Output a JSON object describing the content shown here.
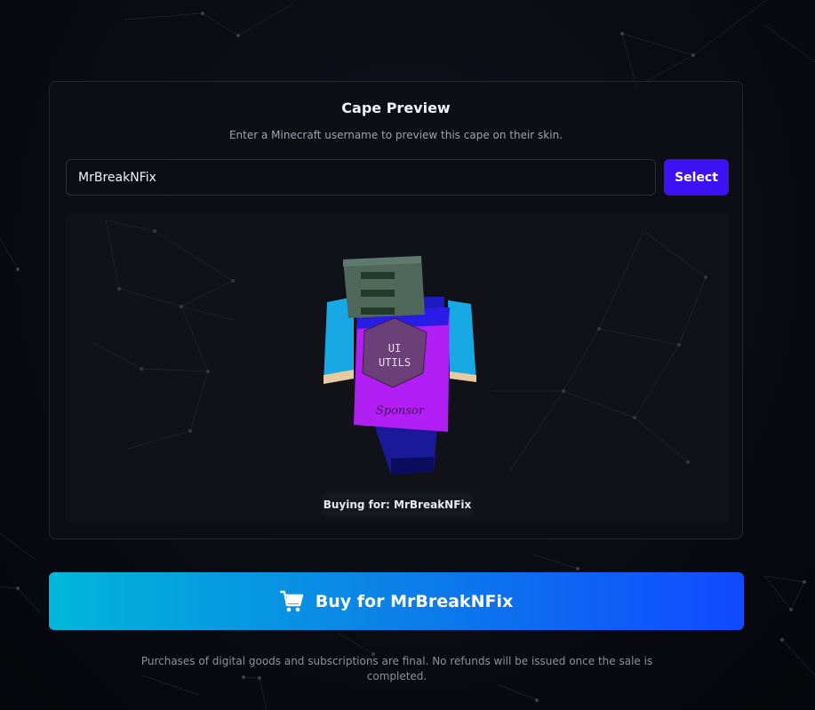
{
  "preview": {
    "title": "Cape Preview",
    "subtitle": "Enter a Minecraft username to preview this cape on their skin.",
    "username_value": "MrBreakNFix",
    "select_label": "Select",
    "buying_for": "Buying for: MrBreakNFix"
  },
  "purchase": {
    "button_label": "Buy for MrBreakNFix",
    "disclaimer": "Purchases of digital goods and subscriptions are final. No refunds will be issued once the sale is completed."
  },
  "cape": {
    "logo_text_line1": "UI",
    "logo_text_line2": "UTILS",
    "banner_text": "Sponsor"
  },
  "icons": {
    "cart": "shopping-cart-icon"
  },
  "colors": {
    "accent_select": "#3c12f5",
    "buy_gradient_start": "#00b7d9",
    "buy_gradient_end": "#1149ff",
    "cape_purple": "#b21ff5"
  }
}
